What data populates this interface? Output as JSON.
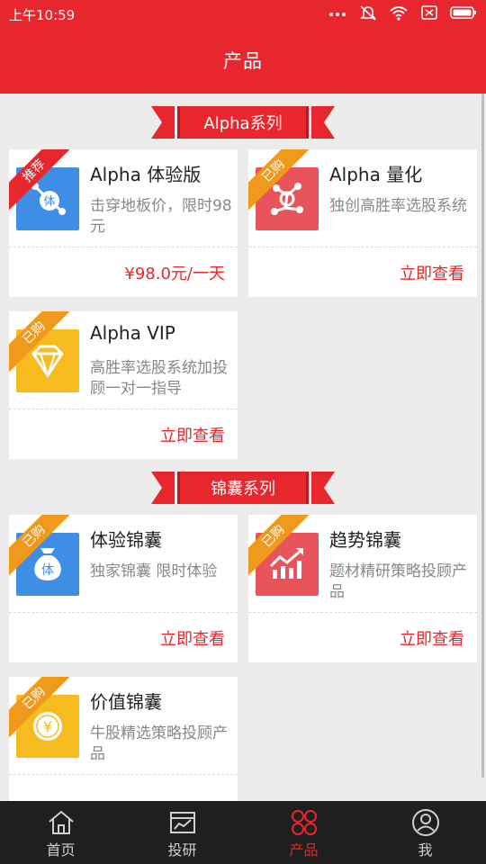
{
  "status_bar": {
    "time": "上午10:59"
  },
  "header": {
    "title": "产品"
  },
  "sections": [
    {
      "label": "Alpha系列"
    },
    {
      "label": "锦囊系列"
    }
  ],
  "cards": [
    {
      "badge": "推荐",
      "name": "Alpha 体验版",
      "desc": "击穿地板价，限时98元",
      "action": "¥98.0元/一天",
      "icon": "alpha-trial-icon",
      "icon_text": "体"
    },
    {
      "badge": "已购",
      "name": "Alpha 量化",
      "desc": "独创高胜率选股系统",
      "action": "立即查看",
      "icon": "alpha-quant-icon"
    },
    {
      "badge": "已购",
      "name": "Alpha VIP",
      "desc": "高胜率选股系统加投顾一对一指导",
      "action": "立即查看",
      "icon": "diamond-icon"
    },
    {
      "badge": "已购",
      "name": "体验锦囊",
      "desc": "独家锦囊 限时体验",
      "action": "立即查看",
      "icon": "money-bag-icon",
      "icon_text": "体"
    },
    {
      "badge": "已购",
      "name": "趋势锦囊",
      "desc": "题材精研策略投顾产品",
      "action": "立即查看",
      "icon": "trend-chart-icon"
    },
    {
      "badge": "已购",
      "name": "价值锦囊",
      "desc": "牛股精选策略投顾产品",
      "action": "",
      "icon": "yuan-coin-icon",
      "icon_text": "¥"
    }
  ],
  "tabs": [
    {
      "label": "首页",
      "icon": "home-icon"
    },
    {
      "label": "投研",
      "icon": "research-icon"
    },
    {
      "label": "产品",
      "icon": "products-icon",
      "active": true
    },
    {
      "label": "我",
      "icon": "profile-icon"
    }
  ],
  "colors": {
    "primary": "#e8262d",
    "badge_orange": "#f09a1c",
    "icon_blue": "#3f8ee6",
    "icon_red": "#e8545a",
    "icon_yellow": "#f6bc1f",
    "tabbar_bg": "#1f1f1f"
  }
}
